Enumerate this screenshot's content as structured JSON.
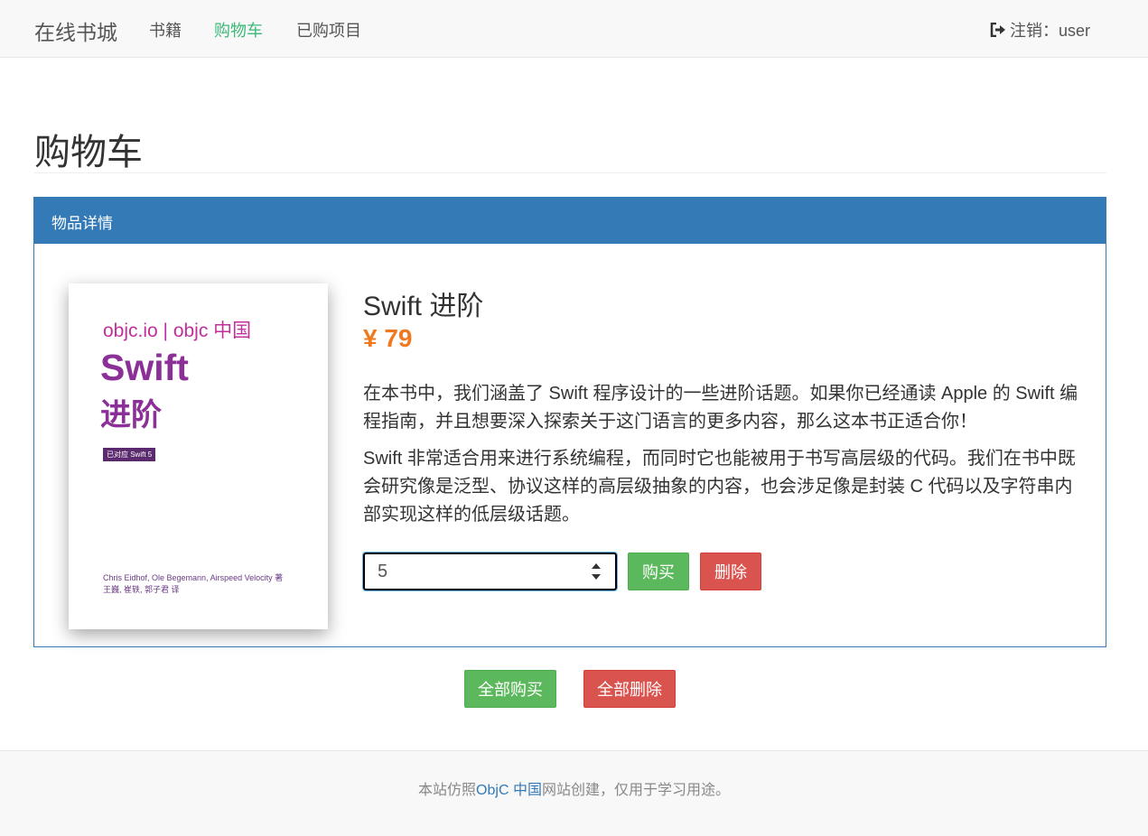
{
  "navbar": {
    "brand": "在线书城",
    "links": [
      "书籍",
      "购物车",
      "已购项目"
    ],
    "logout": "注销：user"
  },
  "page": {
    "title": "购物车"
  },
  "panel": {
    "heading": "物品详情"
  },
  "cover": {
    "site": "objc.io | objc 中国",
    "title_line1": "Swift",
    "title_line2": "进阶",
    "badge": "已对应 Swift 5",
    "authors_line1": "Chris Eidhof, Ole Begemann, Airspeed Velocity 著",
    "authors_line2": "王巍, 崔轶, 郭子君 译"
  },
  "item": {
    "name": "Swift 进阶",
    "price": "¥ 79",
    "description1": "在本书中，我们涵盖了 Swift 程序设计的一些进阶话题。如果你已经通读 Apple 的 Swift 编程指南，并且想要深入探索关于这门语言的更多内容，那么这本书正适合你！",
    "description2": "Swift 非常适合用来进行系统编程，而同时它也能被用于书写高层级的代码。我们在书中既会研究像是泛型、协议这样的高层级抽象的内容，也会涉足像是封装 C 代码以及字符串内部实现这样的低层级话题。",
    "quantity": "5",
    "buy_label": "购买",
    "delete_label": "删除"
  },
  "actions": {
    "buy_all": "全部购买",
    "delete_all": "全部删除"
  },
  "footer": {
    "prefix": "本站仿照",
    "link": "ObjC 中国",
    "suffix": "网站创建，仅用于学习用途。"
  },
  "colors": {
    "primary": "#337ab7",
    "active_nav": "#3cb878",
    "price": "#f0791f",
    "success": "#5cb85c",
    "danger": "#d9534f"
  }
}
